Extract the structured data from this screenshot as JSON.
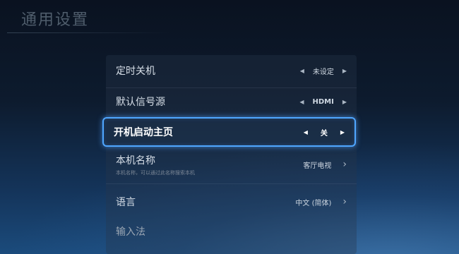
{
  "page": {
    "title": "通用设置"
  },
  "settings": [
    {
      "label": "定时关机",
      "value": "未设定"
    },
    {
      "label": "默认信号源",
      "value": "HDMI"
    },
    {
      "label": "开机启动主页",
      "value": "关"
    },
    {
      "label": "本机名称",
      "sublabel": "本机名称，可以通过此名称搜索本机",
      "value": "客厅电视"
    },
    {
      "label": "语言",
      "value": "中文 (简体)"
    },
    {
      "label": "输入法"
    }
  ],
  "icons": {
    "left": "left-arrow-icon",
    "right": "right-arrow-icon",
    "chevron": "chevron-right-icon"
  },
  "colors": {
    "focus": "#4fa6ff"
  }
}
